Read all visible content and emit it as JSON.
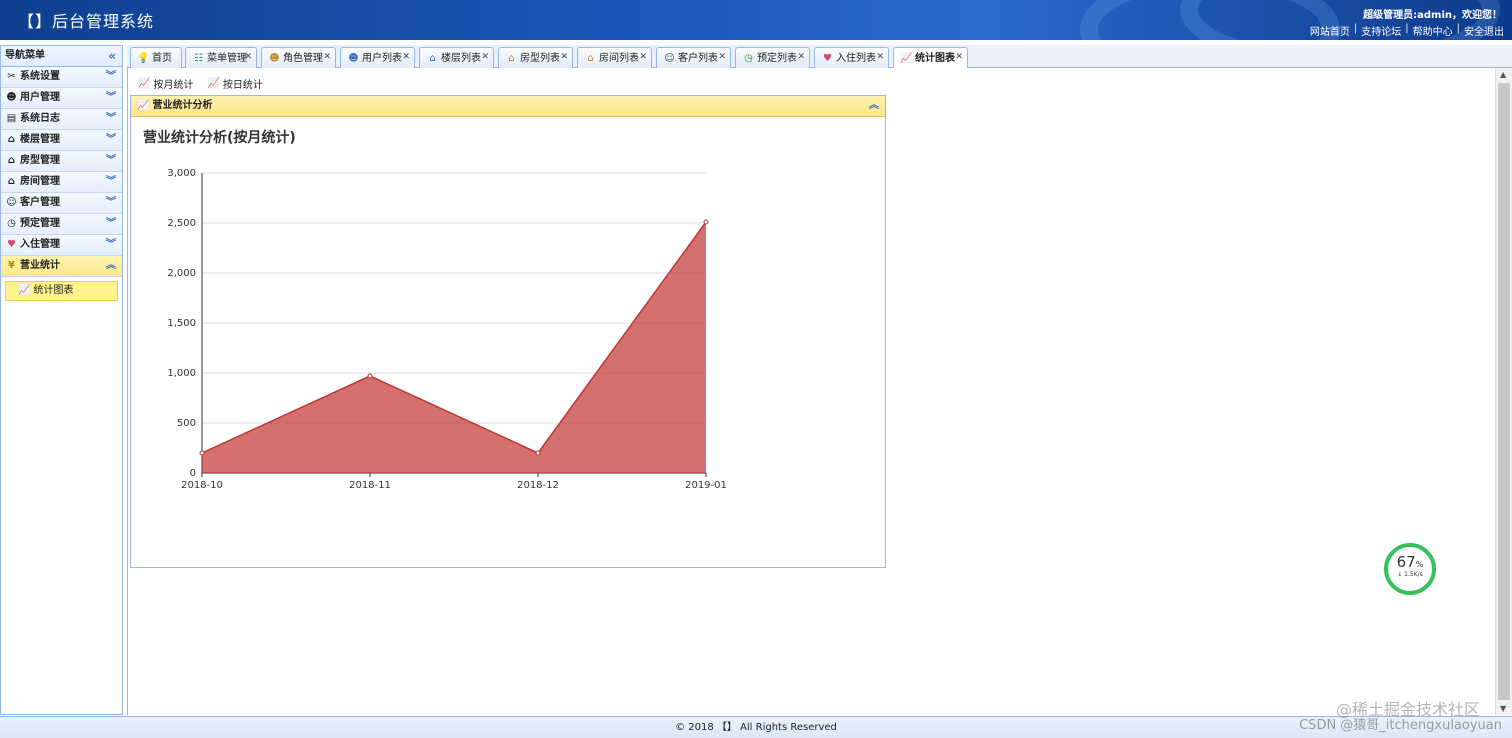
{
  "header": {
    "title": "【】后台管理系统",
    "welcome": "超级管理员:admin，欢迎您！",
    "links": [
      "网站首页",
      "支持论坛",
      "帮助中心",
      "安全退出"
    ]
  },
  "sidebar": {
    "title": "导航菜单",
    "items": [
      {
        "label": "系统设置",
        "icon": "tools-icon"
      },
      {
        "label": "用户管理",
        "icon": "users-icon"
      },
      {
        "label": "系统日志",
        "icon": "log-icon"
      },
      {
        "label": "楼层管理",
        "icon": "house-icon"
      },
      {
        "label": "房型管理",
        "icon": "house-icon"
      },
      {
        "label": "房间管理",
        "icon": "house-icon"
      },
      {
        "label": "客户管理",
        "icon": "customer-icon"
      },
      {
        "label": "预定管理",
        "icon": "clock-icon"
      },
      {
        "label": "入住管理",
        "icon": "heart-icon"
      },
      {
        "label": "营业统计",
        "icon": "yen-icon"
      }
    ],
    "sub_item": "统计图表"
  },
  "tabs": [
    {
      "label": "首页",
      "icon": "bulb-icon",
      "closable": false
    },
    {
      "label": "菜单管理",
      "icon": "tree-icon",
      "closable": true
    },
    {
      "label": "角色管理",
      "icon": "role-icon",
      "closable": true
    },
    {
      "label": "用户列表",
      "icon": "users-icon",
      "closable": true
    },
    {
      "label": "楼层列表",
      "icon": "house-icon",
      "closable": true
    },
    {
      "label": "房型列表",
      "icon": "house-icon",
      "closable": true
    },
    {
      "label": "房间列表",
      "icon": "house-icon",
      "closable": true
    },
    {
      "label": "客户列表",
      "icon": "customer-icon",
      "closable": true
    },
    {
      "label": "预定列表",
      "icon": "clock-icon",
      "closable": true
    },
    {
      "label": "入住列表",
      "icon": "heart-icon",
      "closable": true
    },
    {
      "label": "统计图表",
      "icon": "chart-icon",
      "closable": true
    }
  ],
  "toolbar": {
    "monthly": "按月统计",
    "daily": "按日统计"
  },
  "panel": {
    "title": "营业统计分析"
  },
  "chart_data": {
    "type": "area",
    "title": "营业统计分析(按月统计)",
    "categories": [
      "2018-10",
      "2018-11",
      "2018-12",
      "2019-01"
    ],
    "series": [
      {
        "values": [
          200,
          970,
          200,
          2510
        ],
        "color": "#c23531"
      }
    ],
    "ylim": [
      0,
      3000
    ],
    "yticks": [
      "0",
      "500",
      "1,000",
      "1,500",
      "2,000",
      "2,500",
      "3,000"
    ],
    "xlabel": "",
    "ylabel": "",
    "grid": true
  },
  "gauge": {
    "percent": "67",
    "unit": "%",
    "speed": "↓ 1.5K/s"
  },
  "footer": {
    "text": "© 2018 【】 All Rights Reserved"
  },
  "watermark": {
    "line1": "@稀土掘金技术社区",
    "line2": "CSDN @猿哥_itchengxulaoyuan"
  }
}
